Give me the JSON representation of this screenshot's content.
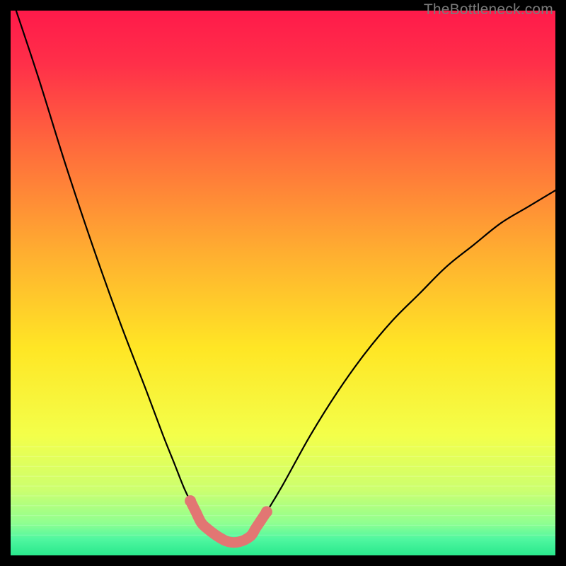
{
  "watermark": "TheBottleneck.com",
  "chart_data": {
    "type": "line",
    "title": "",
    "xlabel": "",
    "ylabel": "",
    "xlim": [
      0,
      100
    ],
    "ylim": [
      0,
      100
    ],
    "grid": false,
    "legend": false,
    "series": [
      {
        "name": "v-curve",
        "color": "#000000",
        "x": [
          0,
          5,
          10,
          15,
          20,
          25,
          28,
          30,
          32,
          34,
          35,
          36,
          38,
          40,
          42,
          44,
          45,
          47,
          50,
          55,
          60,
          65,
          70,
          75,
          80,
          85,
          90,
          95,
          100
        ],
        "values": [
          103,
          88,
          72,
          57,
          43,
          30,
          22,
          17,
          12,
          8,
          6,
          5,
          3.5,
          2.5,
          2.5,
          3.5,
          5,
          8,
          13,
          22,
          30,
          37,
          43,
          48,
          53,
          57,
          61,
          64,
          67
        ]
      },
      {
        "name": "highlight-band",
        "color": "#e27673",
        "x": [
          33,
          34,
          35,
          36,
          38,
          40,
          42,
          44,
          45,
          46,
          47
        ],
        "values": [
          10,
          8,
          6,
          5,
          3.5,
          2.5,
          2.5,
          3.5,
          5,
          6.5,
          8
        ]
      }
    ],
    "background_gradient": {
      "type": "vertical",
      "stops": [
        {
          "pos": 0.0,
          "color": "#ff1a4a"
        },
        {
          "pos": 0.1,
          "color": "#ff3049"
        },
        {
          "pos": 0.25,
          "color": "#ff6a3c"
        },
        {
          "pos": 0.45,
          "color": "#ffb030"
        },
        {
          "pos": 0.62,
          "color": "#ffe625"
        },
        {
          "pos": 0.78,
          "color": "#f3ff4a"
        },
        {
          "pos": 0.88,
          "color": "#ccff6f"
        },
        {
          "pos": 0.94,
          "color": "#90ff90"
        },
        {
          "pos": 0.97,
          "color": "#50f7a0"
        },
        {
          "pos": 1.0,
          "color": "#29e88c"
        }
      ]
    }
  }
}
